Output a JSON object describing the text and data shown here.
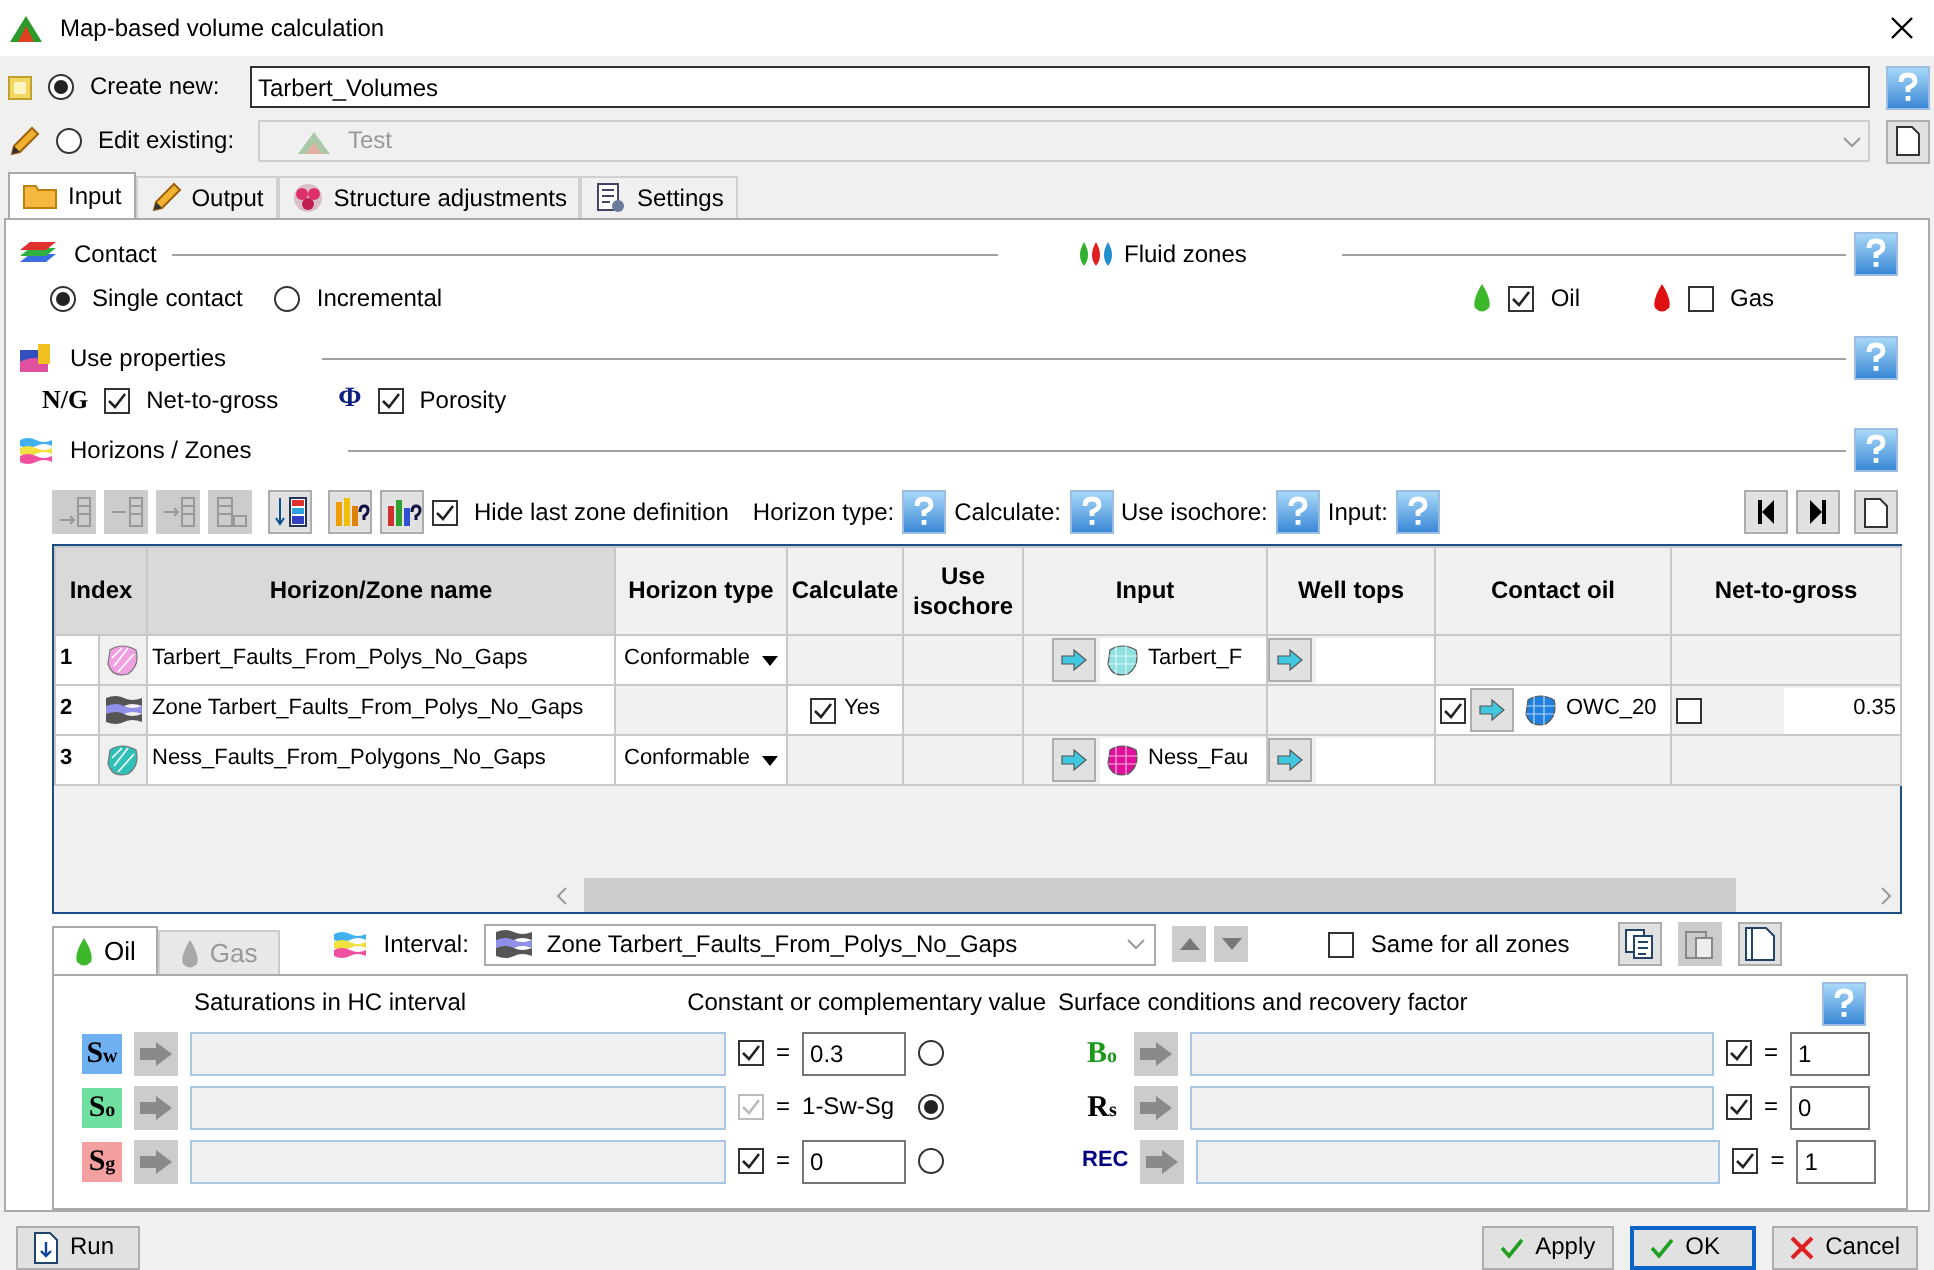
{
  "window": {
    "title": "Map-based volume calculation"
  },
  "target": [
    {
      "kind": "create",
      "label": "Create new:",
      "selected": true,
      "disabled": false,
      "value": "Tarbert_Volumes"
    },
    {
      "kind": "edit",
      "label": "Edit existing:",
      "selected": false,
      "disabled": true,
      "value": "Test"
    }
  ],
  "tabs": [
    {
      "label": "Input",
      "selected": true
    },
    {
      "label": "Output",
      "selected": false
    },
    {
      "label": "Structure adjustments",
      "selected": false
    },
    {
      "label": "Settings",
      "selected": false
    }
  ],
  "contact": {
    "title": "Contact",
    "modes": [
      {
        "label": "Single contact",
        "selected": true
      },
      {
        "label": "Incremental",
        "selected": false
      }
    ]
  },
  "fluid_zones": {
    "title": "Fluid zones",
    "fluids": [
      {
        "label": "Oil",
        "checked": true,
        "color": "#3cb82a"
      },
      {
        "label": "Gas",
        "checked": false,
        "color": "#e01010"
      }
    ]
  },
  "properties": {
    "title": "Use properties",
    "items": [
      {
        "symbol": "N/G",
        "label": "Net-to-gross",
        "checked": true
      },
      {
        "symbol": "Φ",
        "label": "Porosity",
        "checked": true
      }
    ]
  },
  "horizons": {
    "title": "Horizons / Zones",
    "toolbar": [
      {
        "kind": "append",
        "disabled": true
      },
      {
        "kind": "insert",
        "disabled": true
      },
      {
        "kind": "insert-after",
        "disabled": true
      },
      {
        "kind": "delete",
        "disabled": true
      },
      {
        "kind": "sort",
        "disabled": false
      },
      {
        "kind": "bar-help",
        "disabled": false
      },
      {
        "kind": "color-help",
        "disabled": false
      }
    ],
    "hide_last_zone": {
      "label": "Hide last zone definition",
      "checked": true
    },
    "help_labels": [
      "Horizon type:",
      "Calculate:",
      "Use isochore:",
      "Input:"
    ],
    "columns": [
      "Index",
      "Horizon/Zone name",
      "Horizon type",
      "Calculate",
      "Use isochore",
      "Input",
      "Well tops",
      "Contact oil",
      "Net-to-gross"
    ],
    "rows": [
      {
        "index": "1",
        "kind": "horizon",
        "color": "#f0a0e0",
        "name": "Tarbert_Faults_From_Polys_No_Gaps",
        "horizon_type": "Conformable",
        "input": {
          "name": "Tarbert_F",
          "color": "#90e0e0"
        }
      },
      {
        "index": "2",
        "kind": "zone",
        "color": "#9090e8",
        "name": "Zone Tarbert_Faults_From_Polys_No_Gaps",
        "calculate": {
          "checked": true,
          "label": "Yes"
        },
        "contact": {
          "checked": true,
          "name": "OWC_20",
          "color": "#2080e0"
        },
        "ntg": {
          "checked": false,
          "value": "0.35"
        }
      },
      {
        "index": "3",
        "kind": "horizon",
        "color": "#30c0b8",
        "name": "Ness_Faults_From_Polygons_No_Gaps",
        "horizon_type": "Conformable",
        "input": {
          "name": "Ness_Fau",
          "color": "#e0109a"
        }
      }
    ]
  },
  "fluid_tabs": [
    {
      "label": "Oil",
      "selected": true,
      "disabled": false
    },
    {
      "label": "Gas",
      "selected": false,
      "disabled": true
    }
  ],
  "interval": {
    "label": "Interval:",
    "value": "Zone Tarbert_Faults_From_Polys_No_Gaps"
  },
  "same_for_all": {
    "label": "Same for all zones",
    "checked": false
  },
  "saturations": {
    "title": "Saturations in HC interval",
    "value_title": "Constant or complementary value",
    "rows": [
      {
        "symbol": "S$_{w}$",
        "color": "#6fb0f0",
        "checked": true,
        "disabled": false,
        "equals": "=",
        "kind": "field",
        "value": "0.3",
        "selected": false
      },
      {
        "symbol": "S$_{o}$",
        "color": "#70e0a0",
        "checked": true,
        "disabled": true,
        "equals": "=",
        "kind": "text",
        "value": "1-Sw-Sg",
        "selected": true
      },
      {
        "symbol": "S$_{g}$",
        "color": "#f4a0a0",
        "checked": true,
        "disabled": false,
        "equals": "=",
        "kind": "field",
        "value": "0",
        "selected": false
      }
    ]
  },
  "surface": {
    "title": "Surface conditions and recovery factor",
    "rows": [
      {
        "symbol": "B$_{o}$",
        "color": "#189a18",
        "checked": true,
        "equals": "=",
        "value": "1"
      },
      {
        "symbol": "R$_{s}$",
        "color": "#000000",
        "checked": true,
        "equals": "=",
        "value": "0"
      },
      {
        "symbol": "REC",
        "color": "#000080",
        "checked": true,
        "equals": "=",
        "value": "1"
      }
    ]
  },
  "run": {
    "label": "Run"
  },
  "actions": [
    {
      "kind": "apply",
      "label": "Apply",
      "default": false
    },
    {
      "kind": "ok",
      "label": "OK",
      "default": true
    },
    {
      "kind": "cancel",
      "label": "Cancel",
      "default": false
    }
  ]
}
